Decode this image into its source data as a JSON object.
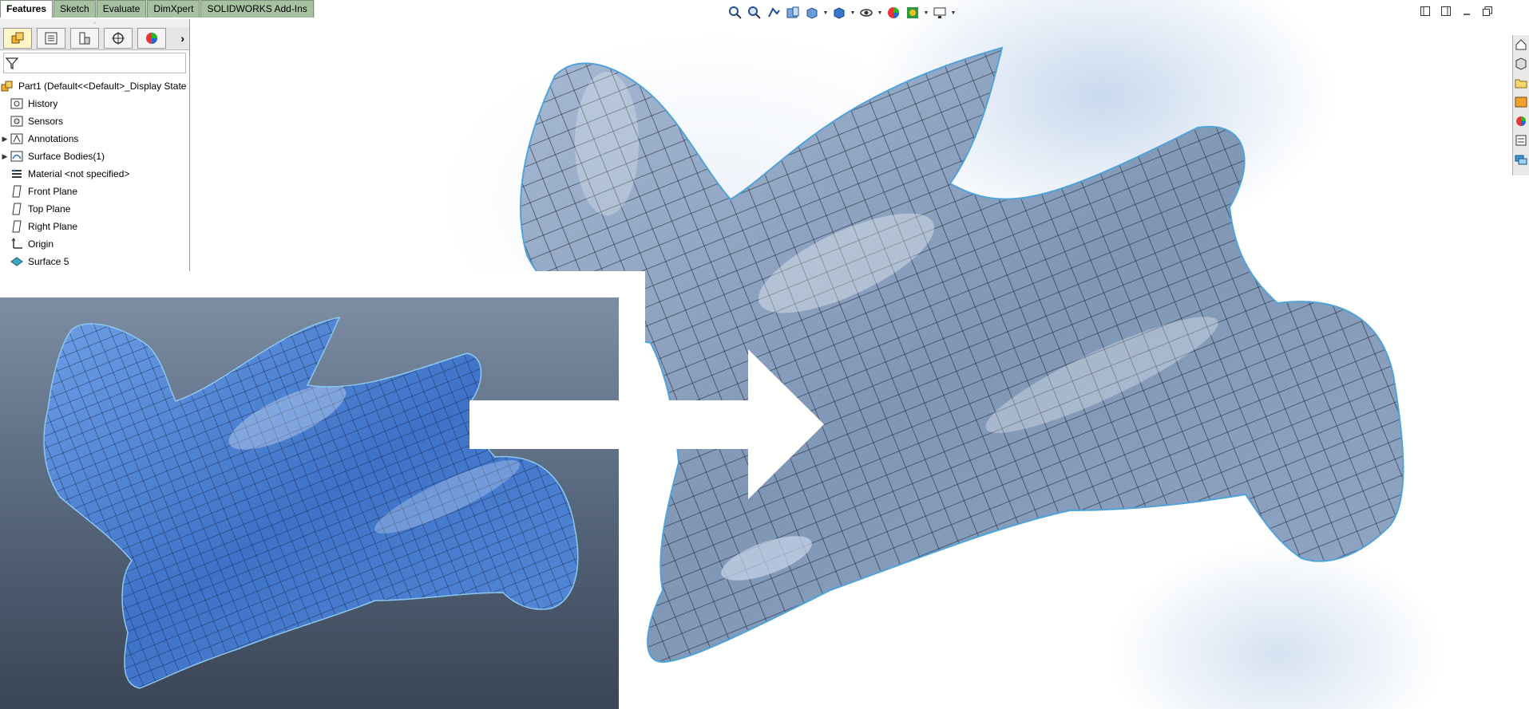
{
  "tabs": {
    "features": "Features",
    "sketch": "Sketch",
    "evaluate": "Evaluate",
    "dimxpert": "DimXpert",
    "addins": "SOLIDWORKS Add-Ins"
  },
  "feature_tree": {
    "root": "Part1  (Default<<Default>_Display State",
    "items": [
      {
        "label": "History",
        "icon": "history-icon"
      },
      {
        "label": "Sensors",
        "icon": "sensors-icon"
      },
      {
        "label": "Annotations",
        "icon": "annotations-icon"
      },
      {
        "label": "Surface Bodies(1)",
        "icon": "surface-bodies-icon"
      },
      {
        "label": "Material <not specified>",
        "icon": "material-icon"
      },
      {
        "label": "Front Plane",
        "icon": "plane-icon"
      },
      {
        "label": "Top Plane",
        "icon": "plane-icon"
      },
      {
        "label": "Right Plane",
        "icon": "plane-icon"
      },
      {
        "label": "Origin",
        "icon": "origin-icon"
      },
      {
        "label": "Surface 5",
        "icon": "surface-icon"
      }
    ]
  },
  "colors": {
    "tab_inactive": "#a7c2a0",
    "model_main": "#8ea3bf",
    "model_inset": "#4a7fd0",
    "mesh_line": "#1b2230"
  }
}
